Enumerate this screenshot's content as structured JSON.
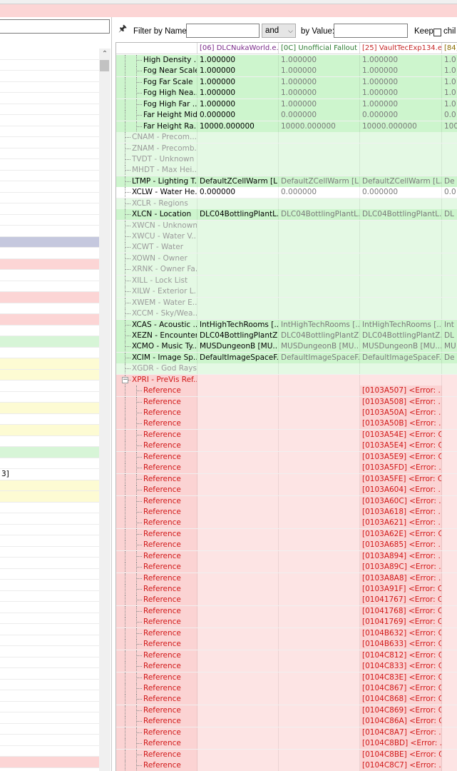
{
  "filter": {
    "by_name_label": "Filter by Name:",
    "operator": "and",
    "by_value_label": "by Value:",
    "keep_label": "Keep",
    "children_label": "chil"
  },
  "columns": [
    {
      "label": "[06] DLCNukaWorld.e...",
      "color": "#7a2a8a"
    },
    {
      "label": "[0C] Unofficial Fallout ...",
      "color": "#2e7d32"
    },
    {
      "label": "[25] VaultTecExp134.e...",
      "color": "#c62828"
    },
    {
      "label": "[84]",
      "color": "#8a6d00"
    }
  ],
  "colors": {
    "green_dark": "#cdf5cd",
    "green_light": "#e4f9e4",
    "red": "#fbd3d3",
    "red_light": "#fde4e4",
    "grey_text": "#9a9a9a",
    "red_text": "#d01818",
    "left_blue": "#c5c8de",
    "left_red": "#fcd5d5",
    "left_green": "#d7f5d7",
    "left_yellow": "#fdfbd3"
  },
  "left_panel": {
    "visible_text": "3]"
  },
  "rows": [
    {
      "name": "High Density ...",
      "level": 2,
      "style": "sub",
      "v": [
        "1.000000",
        "1.000000",
        "1.000000",
        "1.0"
      ]
    },
    {
      "name": "Fog Near Scale",
      "level": 2,
      "style": "sub",
      "v": [
        "1.000000",
        "1.000000",
        "1.000000",
        "1.0"
      ]
    },
    {
      "name": "Fog Far Scale",
      "level": 2,
      "style": "sub",
      "v": [
        "1.000000",
        "1.000000",
        "1.000000",
        "1.0"
      ]
    },
    {
      "name": "Fog High Nea...",
      "level": 2,
      "style": "sub",
      "v": [
        "1.000000",
        "1.000000",
        "1.000000",
        "1.0"
      ]
    },
    {
      "name": "Fog High Far ...",
      "level": 2,
      "style": "sub",
      "v": [
        "1.000000",
        "1.000000",
        "1.000000",
        "1.0"
      ]
    },
    {
      "name": "Far Height Mid",
      "level": 2,
      "style": "sub",
      "v": [
        "0.000000",
        "0.000000",
        "0.000000",
        "0.0"
      ]
    },
    {
      "name": "Far Height Ra...",
      "level": 2,
      "style": "sub",
      "v": [
        "10000.000000",
        "10000.000000",
        "10000.000000",
        "100"
      ]
    },
    {
      "name": "CNAM - Precom...",
      "level": 1,
      "style": "empty",
      "v": [
        "",
        "",
        "",
        ""
      ]
    },
    {
      "name": "ZNAM - Precomb...",
      "level": 1,
      "style": "empty",
      "v": [
        "",
        "",
        "",
        ""
      ]
    },
    {
      "name": "TVDT - Unknown",
      "level": 1,
      "style": "empty",
      "v": [
        "",
        "",
        "",
        ""
      ]
    },
    {
      "name": "MHDT - Max Hei...",
      "level": 1,
      "style": "empty",
      "v": [
        "",
        "",
        "",
        ""
      ]
    },
    {
      "name": "LTMP - Lighting T...",
      "level": 1,
      "style": "normal",
      "v": [
        "DefaultZCellWarm [L...",
        "DefaultZCellWarm [L...",
        "DefaultZCellWarm [L...",
        "De"
      ]
    },
    {
      "name": "XCLW - Water He...",
      "level": 1,
      "style": "white",
      "v": [
        "0.000000",
        "0.000000",
        "0.000000",
        "0.0"
      ]
    },
    {
      "name": "XCLR - Regions",
      "level": 1,
      "style": "empty",
      "v": [
        "",
        "",
        "",
        ""
      ]
    },
    {
      "name": "XLCN - Location",
      "level": 1,
      "style": "normal",
      "v": [
        "DLC04BottlingPlantL...",
        "DLC04BottlingPlantL...",
        "DLC04BottlingPlantL...",
        "DL"
      ]
    },
    {
      "name": "XWCN - Unknown",
      "level": 1,
      "style": "empty",
      "v": [
        "",
        "",
        "",
        ""
      ]
    },
    {
      "name": "XWCU - Water V...",
      "level": 1,
      "style": "empty",
      "v": [
        "",
        "",
        "",
        ""
      ]
    },
    {
      "name": "XCWT - Water",
      "level": 1,
      "style": "empty",
      "v": [
        "",
        "",
        "",
        ""
      ]
    },
    {
      "name": "XOWN - Owner",
      "level": 1,
      "style": "empty",
      "v": [
        "",
        "",
        "",
        ""
      ]
    },
    {
      "name": "XRNK - Owner Fa...",
      "level": 1,
      "style": "empty",
      "v": [
        "",
        "",
        "",
        ""
      ]
    },
    {
      "name": "XILL - Lock List",
      "level": 1,
      "style": "empty",
      "v": [
        "",
        "",
        "",
        ""
      ]
    },
    {
      "name": "XILW - Exterior L...",
      "level": 1,
      "style": "empty",
      "v": [
        "",
        "",
        "",
        ""
      ]
    },
    {
      "name": "XWEM - Water E...",
      "level": 1,
      "style": "empty",
      "v": [
        "",
        "",
        "",
        ""
      ]
    },
    {
      "name": "XCCM - Sky/Wea...",
      "level": 1,
      "style": "empty",
      "v": [
        "",
        "",
        "",
        ""
      ]
    },
    {
      "name": "XCAS - Acoustic ...",
      "level": 1,
      "style": "normal",
      "v": [
        "IntHighTechRooms [...",
        "IntHighTechRooms [...",
        "IntHighTechRooms [...",
        "Int"
      ]
    },
    {
      "name": "XEZN - Encounter...",
      "level": 1,
      "style": "normal",
      "v": [
        "DLC04BottlingPlantZ...",
        "DLC04BottlingPlantZ...",
        "DLC04BottlingPlantZ...",
        "DL"
      ]
    },
    {
      "name": "XCMO - Music Ty...",
      "level": 1,
      "style": "normal",
      "v": [
        "MUSDungeonB [MU...",
        "MUSDungeonB [MU...",
        "MUSDungeonB [MU...",
        "MU"
      ]
    },
    {
      "name": "XCIM - Image Sp...",
      "level": 1,
      "style": "normal",
      "v": [
        "DefaultImageSpaceF...",
        "DefaultImageSpaceF...",
        "DefaultImageSpaceF...",
        "De"
      ]
    },
    {
      "name": "XGDR - God Rays",
      "level": 1,
      "style": "empty",
      "v": [
        "",
        "",
        "",
        ""
      ]
    },
    {
      "name": "XPRI - PreVis Ref...",
      "level": 1,
      "style": "redhead",
      "v": [
        "",
        "",
        "",
        ""
      ]
    },
    {
      "name": "Reference",
      "level": 2,
      "style": "ref",
      "v": [
        "",
        "",
        "[0103A507] <Error: ...",
        ""
      ]
    },
    {
      "name": "Reference",
      "level": 2,
      "style": "ref",
      "v": [
        "",
        "",
        "[0103A508] <Error: ...",
        ""
      ]
    },
    {
      "name": "Reference",
      "level": 2,
      "style": "ref",
      "v": [
        "",
        "",
        "[0103A50A] <Error: ...",
        ""
      ]
    },
    {
      "name": "Reference",
      "level": 2,
      "style": "ref",
      "v": [
        "",
        "",
        "[0103A50B] <Error: ...",
        ""
      ]
    },
    {
      "name": "Reference",
      "level": 2,
      "style": "ref",
      "v": [
        "",
        "",
        "[0103A54E] <Error: C...",
        ""
      ]
    },
    {
      "name": "Reference",
      "level": 2,
      "style": "ref",
      "v": [
        "",
        "",
        "[0103A5E4] <Error: C...",
        ""
      ]
    },
    {
      "name": "Reference",
      "level": 2,
      "style": "ref",
      "v": [
        "",
        "",
        "[0103A5E9] <Error: C...",
        ""
      ]
    },
    {
      "name": "Reference",
      "level": 2,
      "style": "ref",
      "v": [
        "",
        "",
        "[0103A5FD] <Error: ...",
        ""
      ]
    },
    {
      "name": "Reference",
      "level": 2,
      "style": "ref",
      "v": [
        "",
        "",
        "[0103A5FE] <Error: C...",
        ""
      ]
    },
    {
      "name": "Reference",
      "level": 2,
      "style": "ref",
      "v": [
        "",
        "",
        "[0103A604] <Error: ...",
        ""
      ]
    },
    {
      "name": "Reference",
      "level": 2,
      "style": "ref",
      "v": [
        "",
        "",
        "[0103A60C] <Error: ...",
        ""
      ]
    },
    {
      "name": "Reference",
      "level": 2,
      "style": "ref",
      "v": [
        "",
        "",
        "[0103A618] <Error: ...",
        ""
      ]
    },
    {
      "name": "Reference",
      "level": 2,
      "style": "ref",
      "v": [
        "",
        "",
        "[0103A621] <Error: ...",
        ""
      ]
    },
    {
      "name": "Reference",
      "level": 2,
      "style": "ref",
      "v": [
        "",
        "",
        "[0103A62E] <Error: C...",
        ""
      ]
    },
    {
      "name": "Reference",
      "level": 2,
      "style": "ref",
      "v": [
        "",
        "",
        "[0103A685] <Error: ...",
        ""
      ]
    },
    {
      "name": "Reference",
      "level": 2,
      "style": "ref",
      "v": [
        "",
        "",
        "[0103A894] <Error: ...",
        ""
      ]
    },
    {
      "name": "Reference",
      "level": 2,
      "style": "ref",
      "v": [
        "",
        "",
        "[0103A89C] <Error: ...",
        ""
      ]
    },
    {
      "name": "Reference",
      "level": 2,
      "style": "ref",
      "v": [
        "",
        "",
        "[0103A8A8] <Error: ...",
        ""
      ]
    },
    {
      "name": "Reference",
      "level": 2,
      "style": "ref",
      "v": [
        "",
        "",
        "[0103A91F] <Error: C...",
        ""
      ]
    },
    {
      "name": "Reference",
      "level": 2,
      "style": "ref",
      "v": [
        "",
        "",
        "[01041767] <Error: C...",
        ""
      ]
    },
    {
      "name": "Reference",
      "level": 2,
      "style": "ref",
      "v": [
        "",
        "",
        "[01041768] <Error: C...",
        ""
      ]
    },
    {
      "name": "Reference",
      "level": 2,
      "style": "ref",
      "v": [
        "",
        "",
        "[01041769] <Error: C...",
        ""
      ]
    },
    {
      "name": "Reference",
      "level": 2,
      "style": "ref",
      "v": [
        "",
        "",
        "[0104B632] <Error: C...",
        ""
      ]
    },
    {
      "name": "Reference",
      "level": 2,
      "style": "ref",
      "v": [
        "",
        "",
        "[0104B633] <Error: C...",
        ""
      ]
    },
    {
      "name": "Reference",
      "level": 2,
      "style": "ref",
      "v": [
        "",
        "",
        "[0104C812] <Error: C...",
        ""
      ]
    },
    {
      "name": "Reference",
      "level": 2,
      "style": "ref",
      "v": [
        "",
        "",
        "[0104C833] <Error: C...",
        ""
      ]
    },
    {
      "name": "Reference",
      "level": 2,
      "style": "ref",
      "v": [
        "",
        "",
        "[0104C83E] <Error: C...",
        ""
      ]
    },
    {
      "name": "Reference",
      "level": 2,
      "style": "ref",
      "v": [
        "",
        "",
        "[0104C867] <Error: C...",
        ""
      ]
    },
    {
      "name": "Reference",
      "level": 2,
      "style": "ref",
      "v": [
        "",
        "",
        "[0104C868] <Error: C...",
        ""
      ]
    },
    {
      "name": "Reference",
      "level": 2,
      "style": "ref",
      "v": [
        "",
        "",
        "[0104C869] <Error: C...",
        ""
      ]
    },
    {
      "name": "Reference",
      "level": 2,
      "style": "ref",
      "v": [
        "",
        "",
        "[0104C86A] <Error: C...",
        ""
      ]
    },
    {
      "name": "Reference",
      "level": 2,
      "style": "ref",
      "v": [
        "",
        "",
        "[0104C8A7] <Error: ...",
        ""
      ]
    },
    {
      "name": "Reference",
      "level": 2,
      "style": "ref",
      "v": [
        "",
        "",
        "[0104C8BD] <Error: ...",
        ""
      ]
    },
    {
      "name": "Reference",
      "level": 2,
      "style": "ref",
      "v": [
        "",
        "",
        "[0104C8BE] <Error: C...",
        ""
      ]
    },
    {
      "name": "Reference",
      "level": 2,
      "style": "ref",
      "v": [
        "",
        "",
        "[0104C8C7] <Error: ...",
        ""
      ]
    }
  ]
}
